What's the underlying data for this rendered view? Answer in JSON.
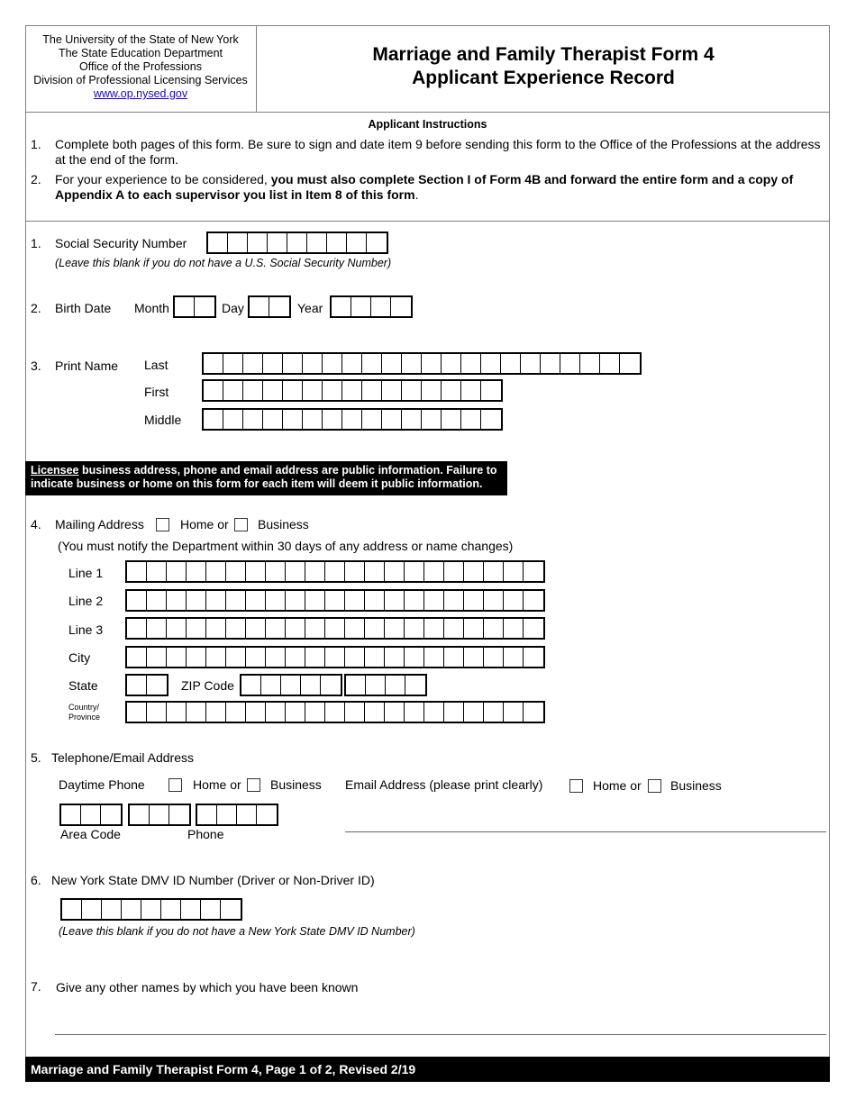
{
  "header": {
    "agency_lines": [
      "The University of the State of New York",
      "The State Education Department",
      "Office of the Professions",
      "Division of Professional Licensing Services"
    ],
    "website_link": "www.op.nysed.gov",
    "title_line1": "Marriage and Family Therapist Form 4",
    "title_line2": "Applicant Experience Record"
  },
  "instructions": {
    "title": "Applicant Instructions",
    "items": [
      {
        "num": "1.",
        "text": "Complete both pages of this form. Be sure to sign and date item 9 before sending this form to the Office of the Professions at the address at the end of the form."
      },
      {
        "num": "2.",
        "text_plain": "For your experience to be considered, ",
        "text_bold": "you must also complete Section I of Form 4B and forward the entire form and a copy of Appendix A to each supervisor you list in Item 8 of this form",
        "text_end": "."
      }
    ]
  },
  "item1": {
    "num": "1.",
    "label": "Social Security Number",
    "boxes": 9,
    "note": "(Leave this blank if you do not have a U.S. Social Security Number)"
  },
  "item2": {
    "num": "2.",
    "label": "Birth Date",
    "month_label": "Month",
    "month_boxes": 2,
    "day_label": "Day",
    "day_boxes": 2,
    "year_label": "Year",
    "year_boxes": 4
  },
  "item3": {
    "num": "3.",
    "label": "Print Name",
    "last_label": "Last",
    "last_boxes": 22,
    "first_label": "First",
    "first_boxes": 15,
    "middle_label": "Middle",
    "middle_boxes": 15
  },
  "notice": {
    "underlined": "Licensee",
    "text": " business address, phone and email address are public information. Failure to indicate business or home on this form for each item will deem it public information."
  },
  "item4": {
    "num": "4.",
    "label": "Mailing Address",
    "home_label": "Home or",
    "business_label": "Business",
    "note": "(You must notify the Department within 30 days of any address or name changes)",
    "line1_label": "Line 1",
    "line2_label": "Line 2",
    "line3_label": "Line 3",
    "city_label": "City",
    "state_label": "State",
    "state_boxes": 2,
    "zip_label": "ZIP Code",
    "zip5_boxes": 5,
    "zip4_boxes": 4,
    "country_label_1": "Country/",
    "country_label_2": "Province",
    "line_boxes": 21
  },
  "item5": {
    "num": "5.",
    "label": "Telephone/Email Address",
    "phone_label": "Daytime Phone",
    "phone_home_label": "Home or",
    "phone_business_label": "Business",
    "email_label": "Email Address (please print clearly)",
    "email_home_label": "Home or",
    "email_business_label": "Business",
    "area_code_label": "Area Code",
    "phone_sub_label": "Phone",
    "area_boxes": 3,
    "prefix_boxes": 3,
    "line_boxes": 4
  },
  "item6": {
    "num": "6.",
    "label": "New York State DMV ID Number (Driver or Non-Driver ID)",
    "boxes": 9,
    "note": "(Leave this blank if you do not have a New York State DMV ID Number)"
  },
  "item7": {
    "num": "7.",
    "label": "Give any other names by which you have been known"
  },
  "footer": {
    "text": "Marriage and Family Therapist Form 4, Page 1 of 2, Revised 2/19"
  }
}
